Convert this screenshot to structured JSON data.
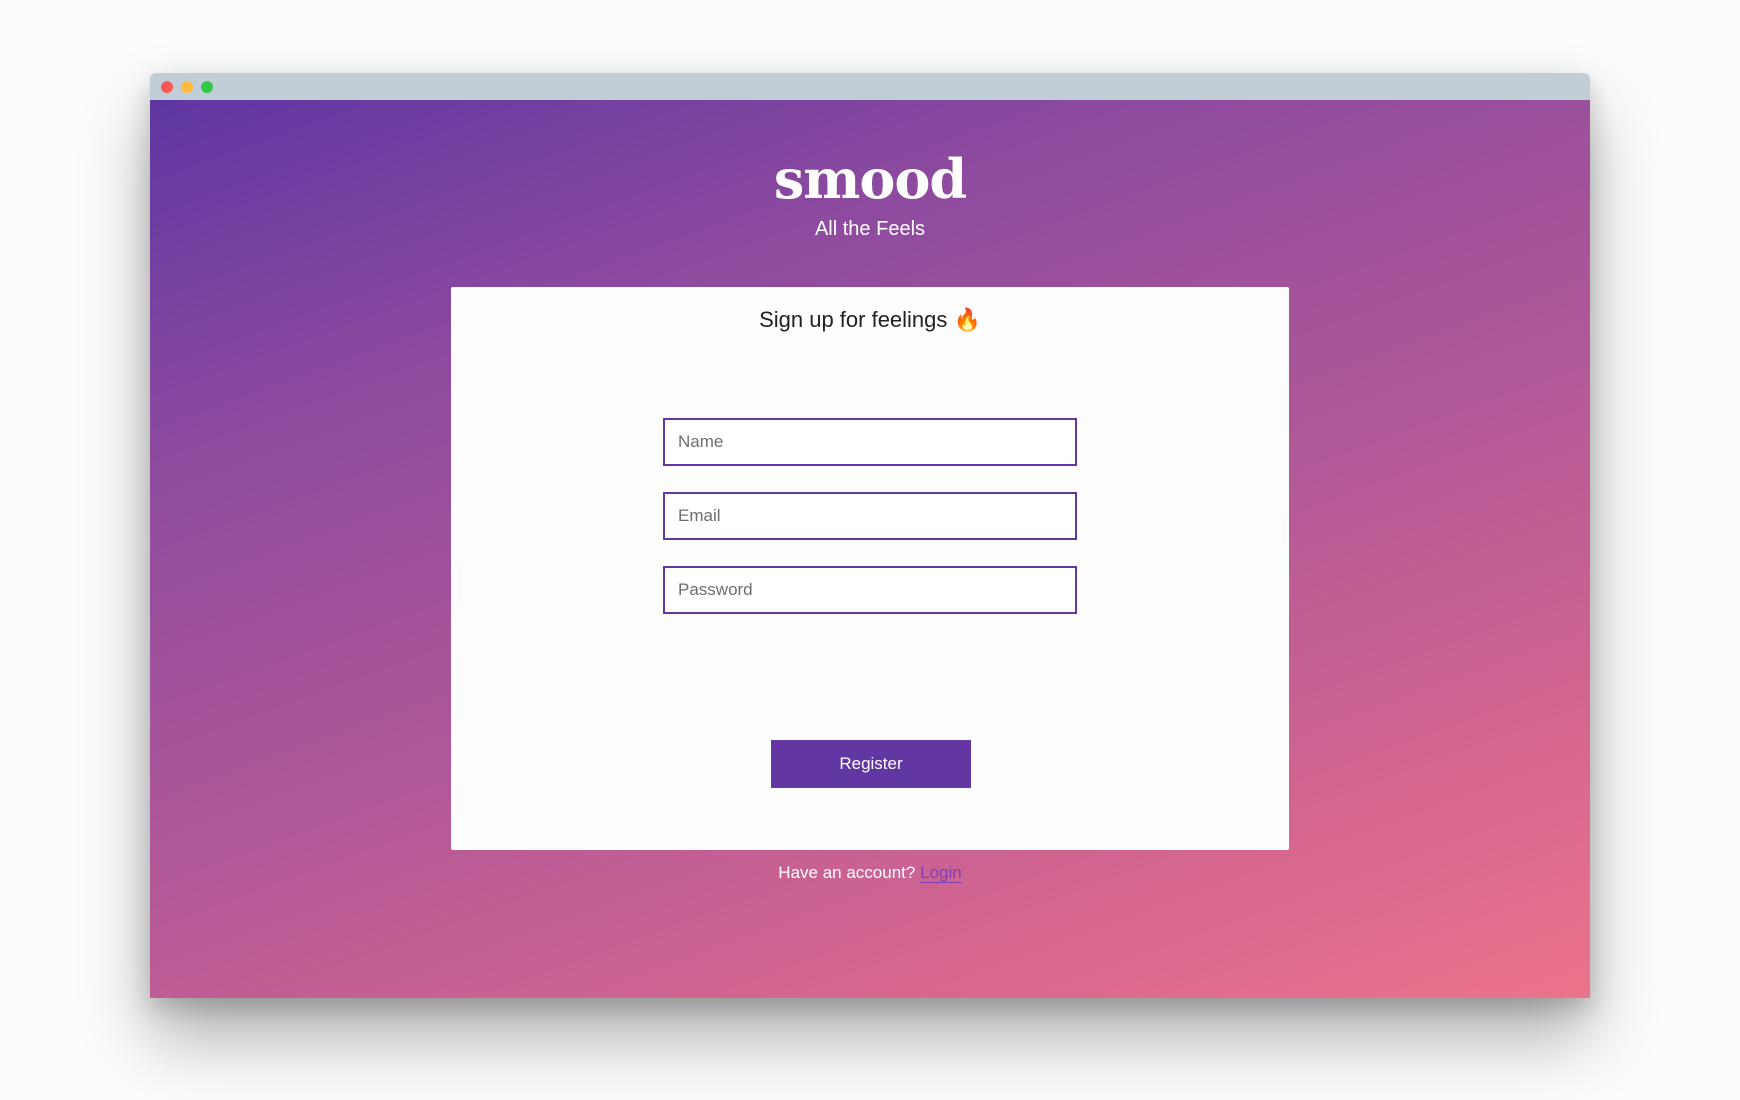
{
  "app": {
    "logo": "smood",
    "tagline": "All the Feels"
  },
  "card": {
    "title": "Sign up for feelings 🔥"
  },
  "form": {
    "name_placeholder": "Name",
    "email_placeholder": "Email",
    "password_placeholder": "Password",
    "submit_label": "Register"
  },
  "footer": {
    "prompt": "Have an account?",
    "login_label": "Login"
  },
  "colors": {
    "accent": "#6236a3",
    "gradient_start": "#5f36a2",
    "gradient_end": "#ed738c",
    "link": "#7c3fb4"
  }
}
